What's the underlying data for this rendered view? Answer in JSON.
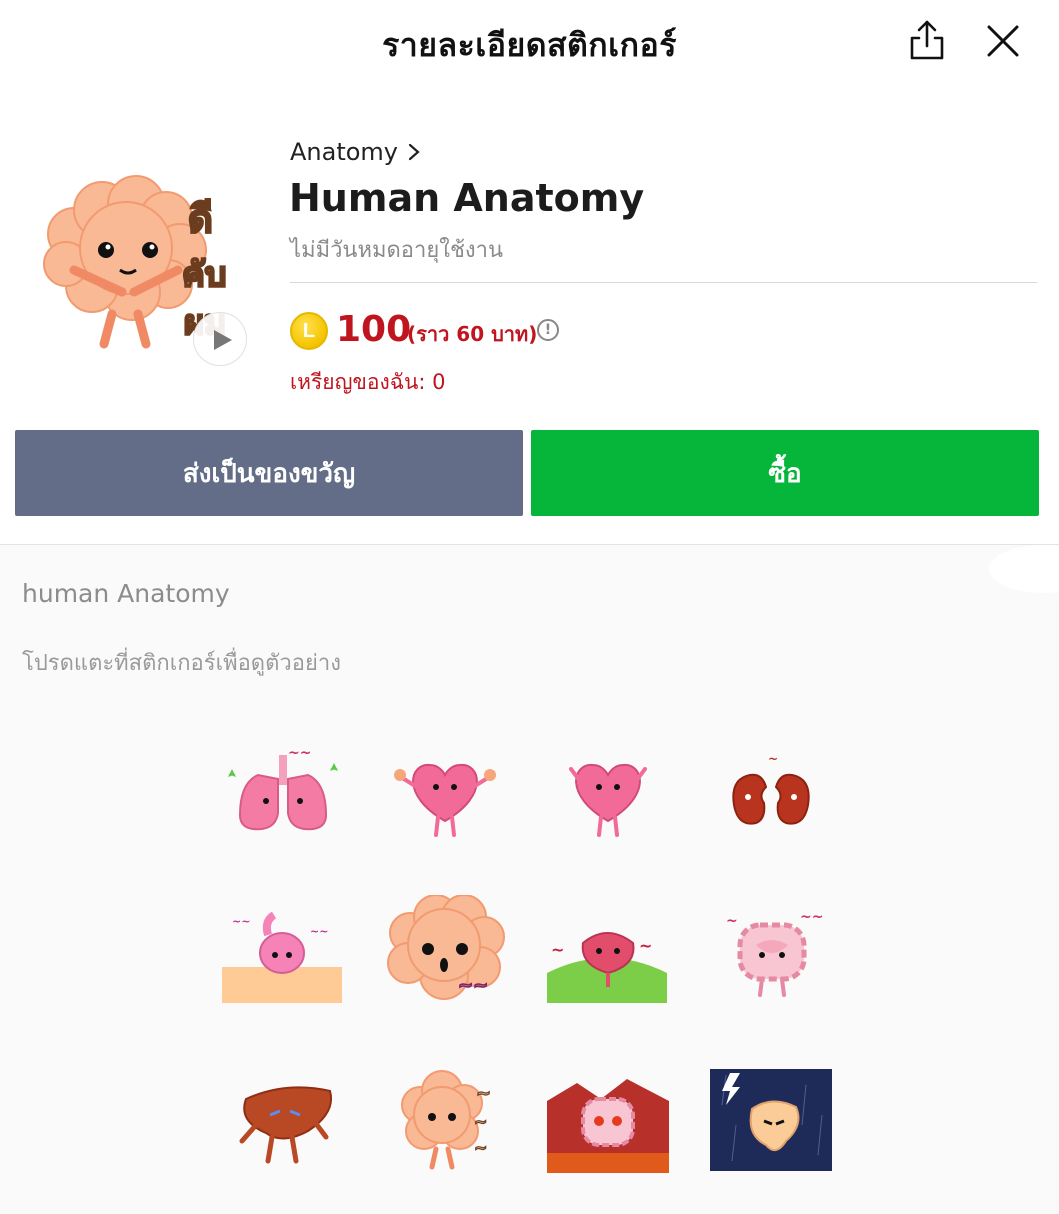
{
  "header": {
    "title": "รายละเอียดสติกเกอร์",
    "share_icon": "share-icon",
    "close_icon": "close-icon"
  },
  "product": {
    "category": "Anatomy",
    "title": "Human Anatomy",
    "expiry": "ไม่มีวันหมดอายุใช้งาน",
    "coin_letter": "L",
    "price": "100",
    "price_approx": "(ราว  60 บาท)",
    "info_glyph": "!",
    "coin_balance": "เหรียญของฉัน: 0",
    "main_sticker_text": [
      "ดี",
      "คับ",
      "ผม"
    ]
  },
  "actions": {
    "gift_label": "ส่งเป็นของขวัญ",
    "buy_label": "ซื้อ"
  },
  "gallery": {
    "set_name": "human Anatomy",
    "hint": "โปรดแตะที่สติกเกอร์เพื่อดูตัวอย่าง",
    "stickers": [
      {
        "name": "lungs-sticker"
      },
      {
        "name": "heart-sticker"
      },
      {
        "name": "heart-wave-sticker"
      },
      {
        "name": "kidneys-sticker"
      },
      {
        "name": "stomach-peek-sticker"
      },
      {
        "name": "brain-shock-sticker"
      },
      {
        "name": "bladder-sticker"
      },
      {
        "name": "intestine-sticker"
      },
      {
        "name": "liver-sticker"
      },
      {
        "name": "brain-thanks-sticker"
      },
      {
        "name": "intestine-angry-sticker"
      },
      {
        "name": "stomach-storm-sticker"
      }
    ]
  },
  "colors": {
    "buy": "#06b63b",
    "gift": "#646d87",
    "price": "#c0141f"
  }
}
